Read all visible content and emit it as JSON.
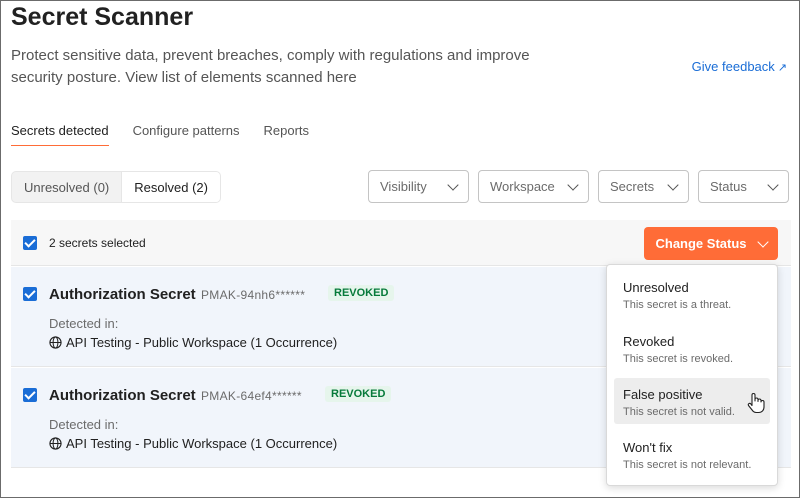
{
  "header": {
    "title": "Secret Scanner",
    "description": "Protect sensitive data, prevent breaches, comply with regulations and improve security posture. View list of elements scanned here",
    "feedback_label": "Give feedback",
    "feedback_arrow": "↗"
  },
  "tabs": [
    {
      "label": "Secrets detected",
      "active": true
    },
    {
      "label": "Configure patterns",
      "active": false
    },
    {
      "label": "Reports",
      "active": false
    }
  ],
  "segmented": {
    "unresolved_label": "Unresolved (0)",
    "resolved_label": "Resolved (2)"
  },
  "filters": {
    "visibility": "Visibility",
    "workspace": "Workspace",
    "secrets": "Secrets",
    "status": "Status"
  },
  "selection": {
    "text": "2 secrets selected",
    "change_status_label": "Change Status"
  },
  "rows": [
    {
      "name": "Authorization Secret",
      "key": "PMAK-94nh6******",
      "badge": "REVOKED",
      "detected_label": "Detected in:",
      "workspace": "API Testing - Public Workspace (1 Occurrence)"
    },
    {
      "name": "Authorization Secret",
      "key": "PMAK-64ef4******",
      "badge": "REVOKED",
      "detected_label": "Detected in:",
      "workspace": "API Testing - Public Workspace (1 Occurrence)"
    }
  ],
  "status_menu": [
    {
      "title": "Unresolved",
      "desc": "This secret is a threat."
    },
    {
      "title": "Revoked",
      "desc": "This secret is revoked."
    },
    {
      "title": "False positive",
      "desc": "This secret is not valid.",
      "hovered": true
    },
    {
      "title": "Won't fix",
      "desc": "This secret is not relevant."
    }
  ],
  "colors": {
    "accent": "#ff6c37",
    "link": "#1a6dd6",
    "checkbox": "#1a6dd6",
    "badge_text": "#067a3a"
  }
}
